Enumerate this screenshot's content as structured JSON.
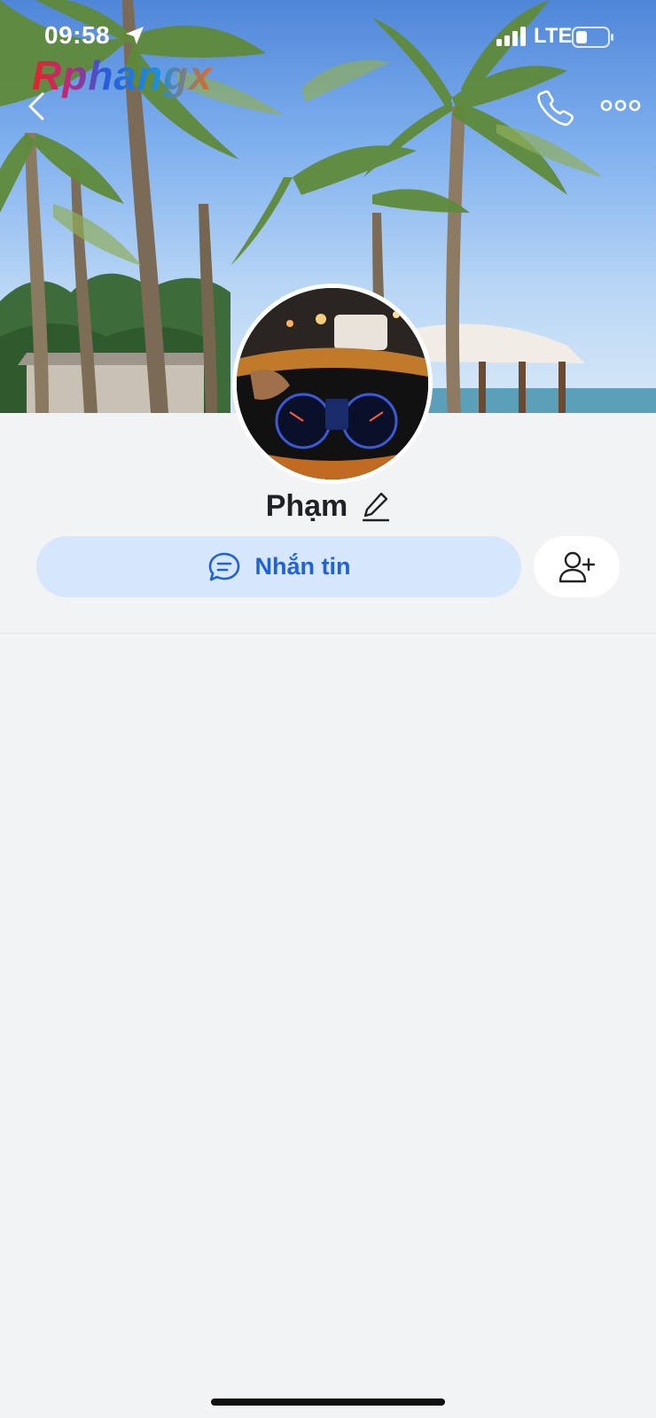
{
  "status_bar": {
    "time": "09:58",
    "network": "LTE"
  },
  "watermark": "Rphangx",
  "profile": {
    "name": "Phạm"
  },
  "actions": {
    "message_label": "Nhắn tin"
  },
  "icons": {
    "back": "chevron-left-icon",
    "call": "phone-icon",
    "more": "more-icon",
    "edit": "pencil-icon",
    "message": "chat-bubble-icon",
    "add_friend": "add-user-icon"
  },
  "colors": {
    "accent": "#1f62d6",
    "accent_bg": "#d6e6fd",
    "background": "#f2f3f5"
  }
}
